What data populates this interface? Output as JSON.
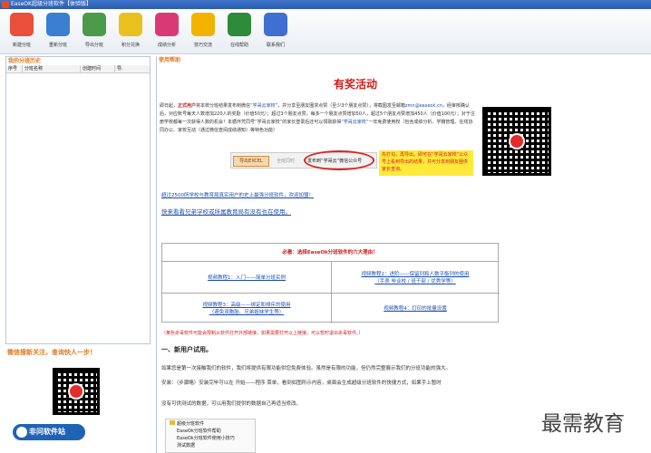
{
  "window": {
    "title": "EaseOK超级分班软件【体验版】"
  },
  "toolbar": {
    "buttons": [
      {
        "label": "新建分班",
        "icon": "new-class-icon",
        "color": "#e94f3b"
      },
      {
        "label": "重新分班",
        "icon": "reclass-icon",
        "color": "#3a7fd0"
      },
      {
        "label": "导出分班",
        "icon": "export-icon",
        "color": "#4b9b4a"
      },
      {
        "label": "积分兑换",
        "icon": "points-exchange-icon",
        "color": "#e8c11f"
      },
      {
        "label": "成绩分析",
        "icon": "score-analysis-icon",
        "color": "#d93a73"
      },
      {
        "label": "技巧交流",
        "icon": "tips-star-icon",
        "color": "#f2b300"
      },
      {
        "label": "在线帮助",
        "icon": "online-help-icon",
        "color": "#2e8b3a"
      },
      {
        "label": "联系我们",
        "icon": "contact-icon",
        "color": "#3f6fd1"
      }
    ]
  },
  "left": {
    "history_title": "我的分班历史",
    "columns": [
      "序号",
      "分班名称",
      "创建时间",
      "导."
    ],
    "wechat_title": "微信搜新关注，查询快人一步！",
    "brand": "非问软件站"
  },
  "main": {
    "help_title": "使用帮助",
    "promo_title": "有奖活动",
    "promo_text_1": "即日起，",
    "promo_text_bold": "正式用户",
    "promo_text_2": "将本校分班结果发布到微信",
    "promo_text_link": "“学哥云家校”",
    "promo_text_3": "，并分享至朋友圈求点赞（至少3个朋友点赞），将截图发至邮箱",
    "promo_email": "zmn@easeok.cn",
    "promo_text_4": "，经审核确认后，对应账号每天人数增加220人的奖励（价值50元）；超过3个朋友点赞，每多一个朋友点赞增加50人，超过5个朋友点赞增加450人（价值100元）；对于注册学校都每一次获得人数的机会！本循环凭同号“学哥云家校”",
    "promo_text_5": "的家长登录后还可以领取获得",
    "promo_text_6": "“学哥云家校”",
    "promo_text_7": "一年免费使用权（包含成绩分析、学籍管理、在线协同办公、家校互动（通过微信查阅成绩通知）等特色功能）",
    "demo_button": "导出EXCEL",
    "demo_opt1": "全班同时",
    "demo_opt2": "发布到“学哥云”微信公众号",
    "yellow_note": "先打勾，再导出，即可在“学哥云家校”公众号上看到导出的结果，并可分享到朋友圈供家长查询。",
    "link_1": "超过2500所学校与教育局真实用户的史上最强分班软件，欢迎加盟！",
    "link_2": "快来看看兄弟学校或所属教育局有没有也在使用。",
    "reasons_title": "必看：选择EaseOk分班软件的六大理由！",
    "reason_1": "视频教程1：入门——简单分班实例",
    "reason_2a": "视频教程2：进阶——保留列和人数平衡列的使用",
    "reason_2b": "（手表 毕业校 / 班干部 / 优秀学等）",
    "reason_3a": "视频教程3：高级——绑定和排斥的使用",
    "reason_3b": "（避免双胞胎、兄弟姐妹学生等）",
    "reason_4": "视频教程4：打印的批量设置",
    "red_note": "（某些杀毒软件可能会限制从软件打开外部链接，如果需要打开以上链接，可以暂时退出杀毒软件。）",
    "section_head": "一、新用户试用。",
    "para_1": "如果您是第一次接触我们的软件，我们将提供有限功能供您免费体验。虽然是有限的功能，但仍然完整展示我们的分班功能的强大。",
    "para_2": "安装：（步骤略）安装完毕可以在 开始——程序 菜单，看到如图所示内容，桌面会生成超级分班软件的快捷方式，如果手上暂时",
    "para_3": "没有可供测试的数据，可以用我们提供的数据自己再适当修改。",
    "tree": [
      "超级分班软件",
      "EaseOk分班软件帮助",
      "EaseOk分班软件使用小技巧",
      "测试数据"
    ]
  },
  "watermark": "最需教育"
}
